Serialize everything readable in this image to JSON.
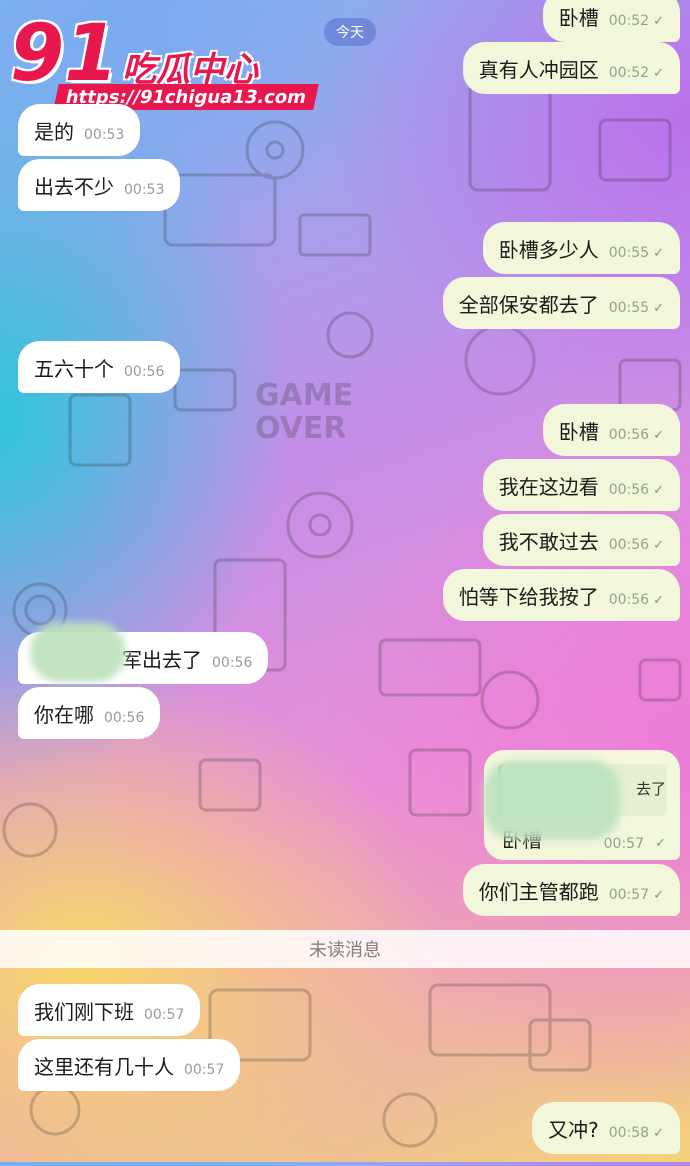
{
  "watermark": {
    "number": "91",
    "title": "吃瓜中心",
    "url": "https://91chigua13.com"
  },
  "date_chip": "今天",
  "unread_label": "未读消息",
  "messages": [
    {
      "text": "卧槽",
      "time": "00:52",
      "dir": "out"
    },
    {
      "text": "真有人冲园区",
      "time": "00:52",
      "dir": "out"
    },
    {
      "text": "是的",
      "time": "00:53",
      "dir": "in"
    },
    {
      "text": "出去不少",
      "time": "00:53",
      "dir": "in"
    },
    {
      "text": "卧槽多少人",
      "time": "00:55",
      "dir": "out"
    },
    {
      "text": "全部保安都去了",
      "time": "00:55",
      "dir": "out"
    },
    {
      "text": "五六十个",
      "time": "00:56",
      "dir": "in"
    },
    {
      "text": "卧槽",
      "time": "00:56",
      "dir": "out"
    },
    {
      "text": "我在这边看",
      "time": "00:56",
      "dir": "out"
    },
    {
      "text": "我不敢过去",
      "time": "00:56",
      "dir": "out"
    },
    {
      "text": "怕等下给我按了",
      "time": "00:56",
      "dir": "out"
    },
    {
      "text": "军出去了",
      "time": "00:56",
      "dir": "in"
    },
    {
      "text": "你在哪",
      "time": "00:56",
      "dir": "in"
    },
    {
      "text": "卧槽",
      "time": "00:57",
      "dir": "out",
      "quote": "去了"
    },
    {
      "text": "你们主管都跑",
      "time": "00:57",
      "dir": "out"
    },
    {
      "text": "我们刚下班",
      "time": "00:57",
      "dir": "in"
    },
    {
      "text": "这里还有几十人",
      "time": "00:57",
      "dir": "in"
    },
    {
      "text": "又冲?",
      "time": "00:58",
      "dir": "out"
    }
  ],
  "colors": {
    "incoming_bubble": "#ffffff",
    "outgoing_bubble": "#f2f7dc",
    "brand": "#e8184e"
  }
}
